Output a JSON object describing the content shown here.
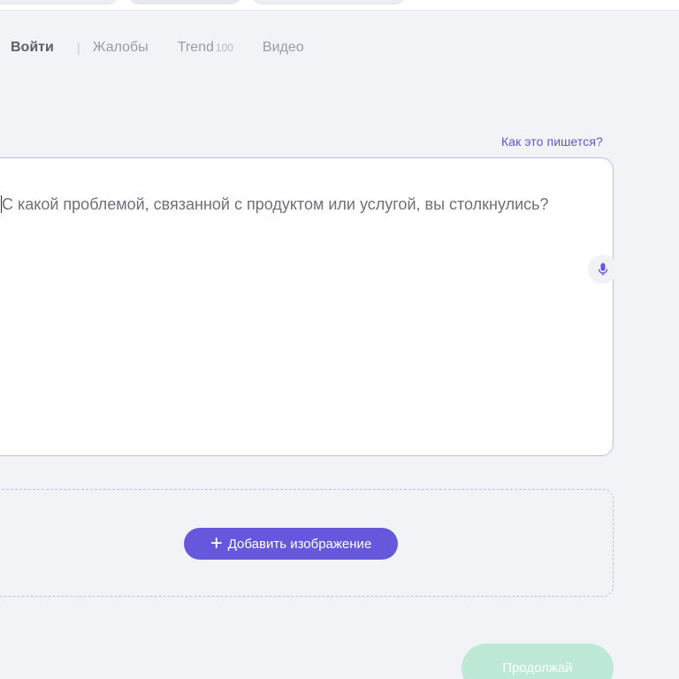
{
  "nav": {
    "login": "Войти",
    "separator": "|",
    "complaints": "Жалобы",
    "trend": "Trend",
    "trend_count": "100",
    "video": "Видео"
  },
  "form": {
    "howto_link": "Как это пишется?",
    "placeholder": "С какой проблемой, связанной с продуктом или услугой, вы столкнулись?",
    "add_image_label": "Добавить изображение",
    "add_image_icon": "plus-icon",
    "mic_icon": "microphone-icon",
    "continue_label": "Продолжай"
  },
  "colors": {
    "accent": "#6558dc",
    "link": "#5d57d3",
    "continue_disabled": "#bde9d6",
    "background": "#f2f3f7"
  }
}
